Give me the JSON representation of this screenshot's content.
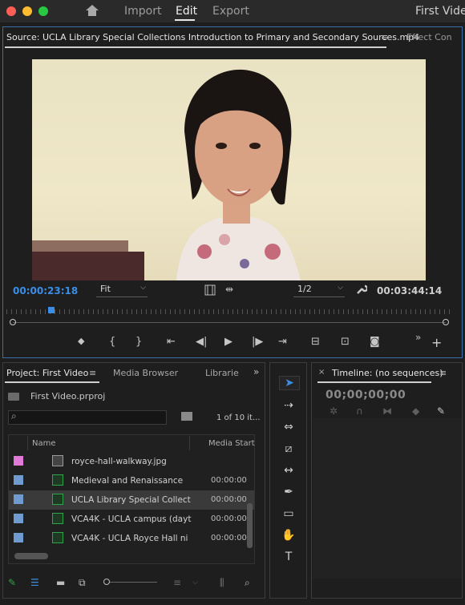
{
  "app": {
    "nav_tabs": [
      "Import",
      "Edit",
      "Export"
    ],
    "project_title": "First Video"
  },
  "source_monitor": {
    "tab_title": "Source: UCLA Library Special Collections Introduction to Primary and Secondary Sources.mp4",
    "menu_icon": "≡",
    "effect_tab": "Effect Con",
    "current_timecode": "00:00:23:18",
    "duration_timecode": "00:03:44:14",
    "zoom_select": "Fit",
    "resolution_select": "1/2",
    "playhead_fraction": 0.1
  },
  "project_panel": {
    "tab_title": "Project: First Video",
    "menu_icon": "≡",
    "media_browser_tab": "Media Browser",
    "libraries_tab": "Librarie",
    "more_icon": "»",
    "project_file": "First Video.prproj",
    "search_placeholder": "",
    "item_count": "1 of 10 it...",
    "columns": [
      "Name",
      "Media Start"
    ],
    "rows": [
      {
        "name": "royce-hall-walkway.jpg",
        "start": "",
        "color": "#e07ad6",
        "kind": "image",
        "selected": false
      },
      {
        "name": "Medieval and Renaissance",
        "start": "00:00:00",
        "color": "#6f9bd1",
        "kind": "sequence",
        "selected": false
      },
      {
        "name": "UCLA Library Special Collect",
        "start": "00:00:00",
        "color": "#6f9bd1",
        "kind": "sequence",
        "selected": true
      },
      {
        "name": "VCA4K - UCLA campus (dayt",
        "start": "00:00:00",
        "color": "#6f9bd1",
        "kind": "sequence",
        "selected": false
      },
      {
        "name": "VCA4K - UCLA Royce Hall ni",
        "start": "00:00:00",
        "color": "#6f9bd1",
        "kind": "sequence",
        "selected": false
      }
    ]
  },
  "timeline": {
    "close_icon": "×",
    "tab_title": "Timeline: (no sequences)",
    "menu_icon": "≡",
    "timecode": "00;00;00;00"
  },
  "colors": {
    "accent": "#3b8ee8",
    "panel_bg": "#1e1e1e",
    "top_bar": "#2a2a2a"
  }
}
